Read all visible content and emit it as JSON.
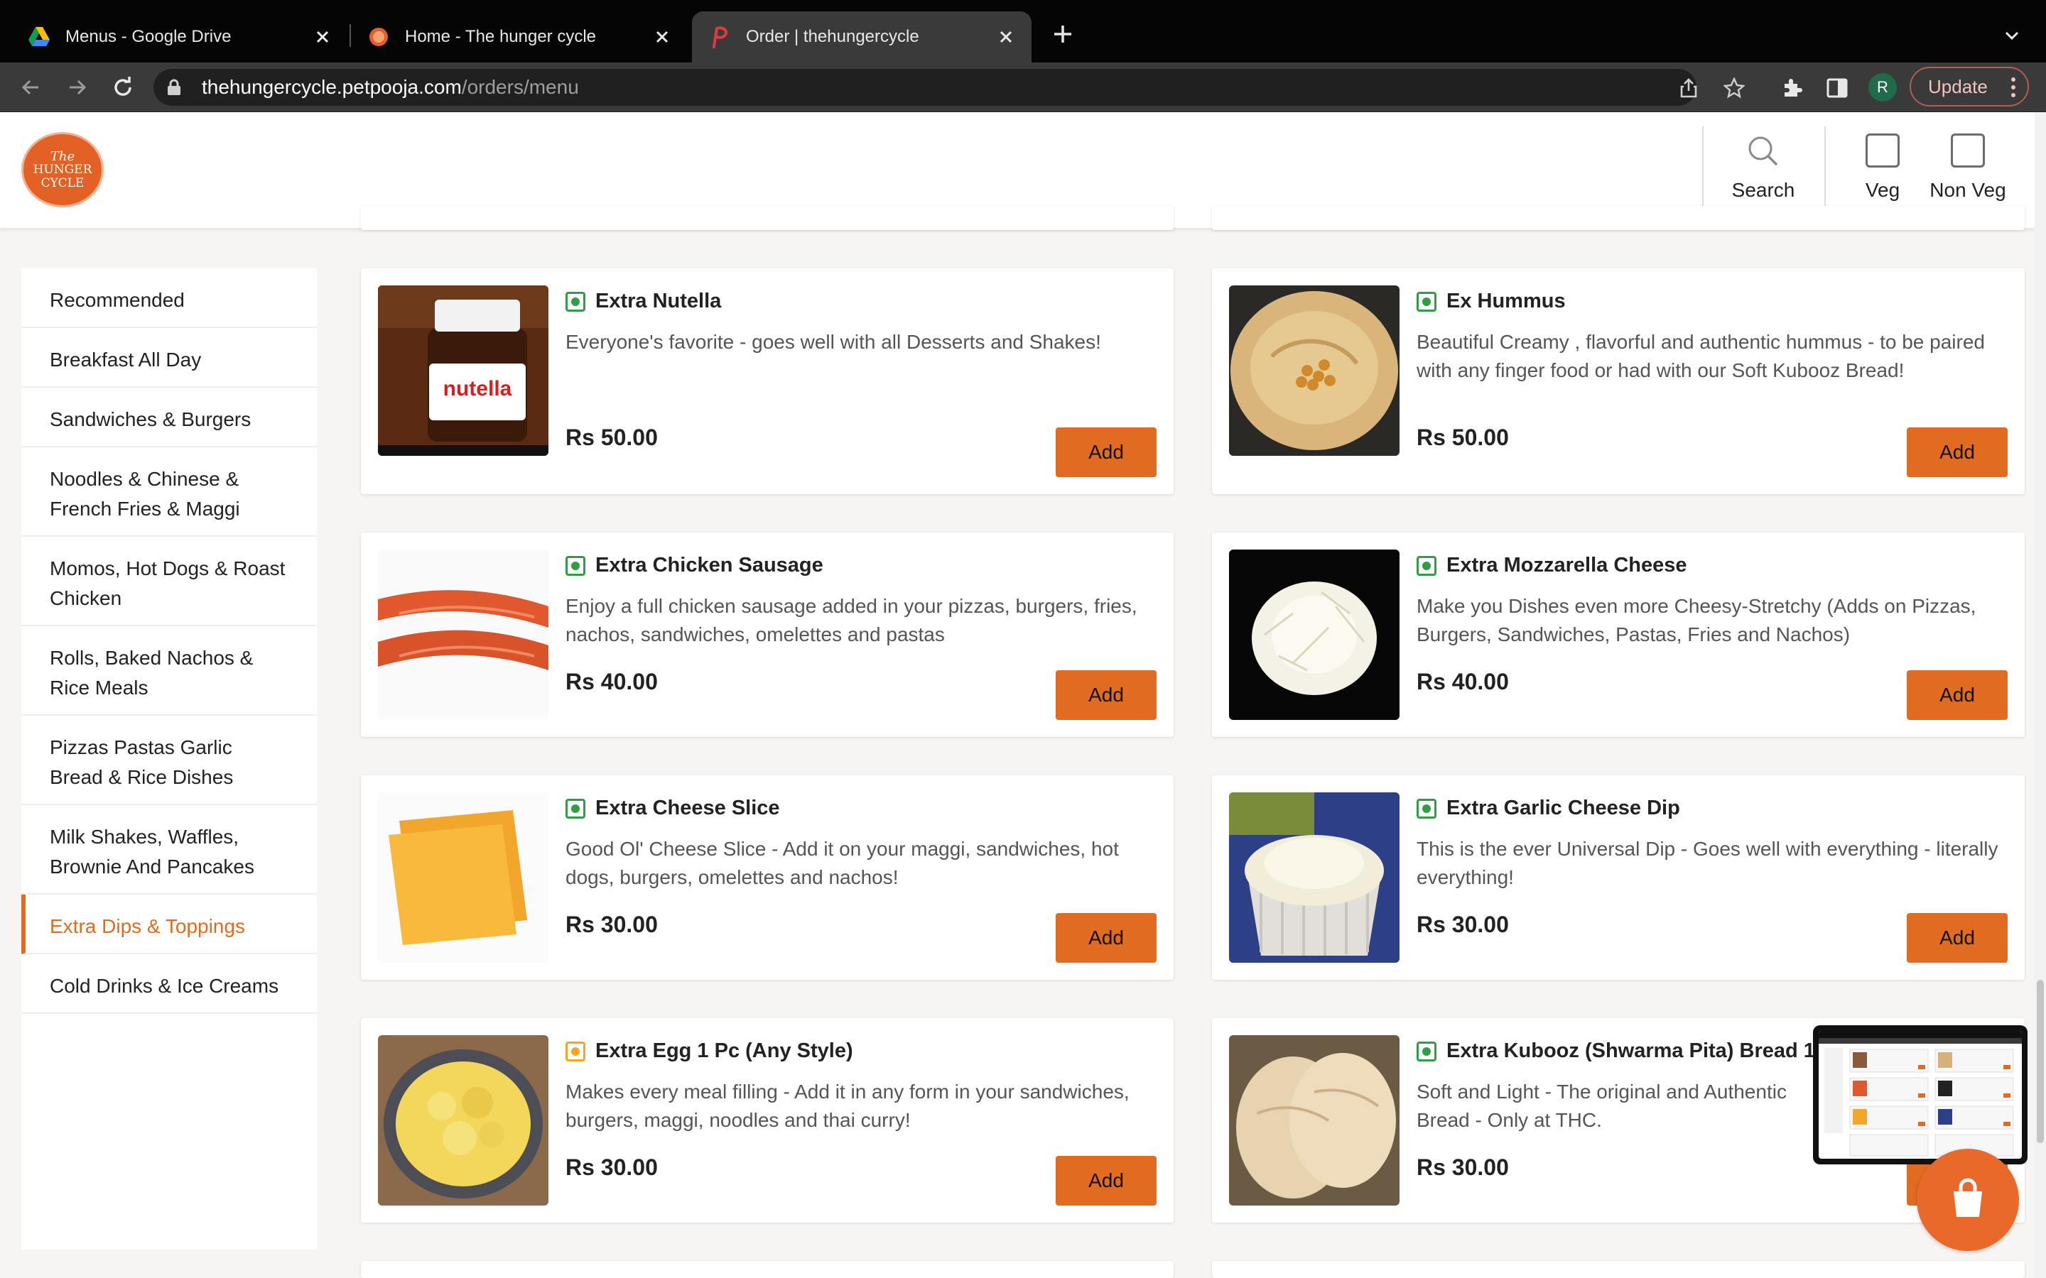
{
  "browser": {
    "tabs": [
      {
        "title": "Menus - Google Drive",
        "icon": "google-drive-icon"
      },
      {
        "title": "Home - The hunger cycle",
        "icon": "site-favicon"
      },
      {
        "title": "Order | thehungercycle",
        "icon": "petpooja-icon"
      }
    ],
    "url_host": "thehungercycle.petpooja.com",
    "url_path": "/orders/menu",
    "profile_initial": "R",
    "update_label": "Update"
  },
  "header": {
    "logo_lines": [
      "The",
      "HUNGER",
      "CYCLE"
    ],
    "search_label": "Search",
    "veg_label": "Veg",
    "nonveg_label": "Non Veg"
  },
  "sidebar": {
    "items": [
      {
        "label": "Recommended"
      },
      {
        "label": "Breakfast All Day"
      },
      {
        "label": "Sandwiches & Burgers"
      },
      {
        "label": "Noodles & Chinese & French Fries & Maggi"
      },
      {
        "label": "Momos, Hot Dogs & Roast Chicken"
      },
      {
        "label": "Rolls, Baked Nachos & Rice Meals"
      },
      {
        "label": "Pizzas Pastas Garlic Bread & Rice Dishes"
      },
      {
        "label": "Milk Shakes, Waffles, Brownie And Pancakes"
      },
      {
        "label": "Extra Dips & Toppings"
      },
      {
        "label": "Cold Drinks & Ice Creams"
      }
    ],
    "active": "Extra Dips & Toppings"
  },
  "menu": {
    "add_label": "Add",
    "items": [
      {
        "name": "Extra Nutella",
        "desc": "Everyone's favorite - goes well with all Desserts and Shakes!",
        "price": "Rs 50.00",
        "type": "veg"
      },
      {
        "name": "Ex Hummus",
        "desc": "Beautiful Creamy , flavorful and authentic hummus - to be paired with any finger food or had with our Soft Kubooz Bread!",
        "price": "Rs 50.00",
        "type": "veg"
      },
      {
        "name": "Extra Chicken Sausage",
        "desc": "Enjoy a full chicken sausage added in your pizzas, burgers, fries, nachos, sandwiches, omelettes and pastas",
        "price": "Rs 40.00",
        "type": "veg"
      },
      {
        "name": "Extra Mozzarella Cheese",
        "desc": "Make you Dishes even more Cheesy-Stretchy (Adds on Pizzas, Burgers, Sandwiches, Pastas, Fries and Nachos)",
        "price": "Rs 40.00",
        "type": "veg"
      },
      {
        "name": "Extra Cheese Slice",
        "desc": "Good Ol' Cheese Slice - Add it on your maggi, sandwiches, hot dogs, burgers, omelettes and nachos!",
        "price": "Rs 30.00",
        "type": "veg"
      },
      {
        "name": "Extra Garlic Cheese Dip",
        "desc": "This is the ever Universal Dip - Goes well with everything - literally everything!",
        "price": "Rs 30.00",
        "type": "veg"
      },
      {
        "name": "Extra Egg 1 Pc (Any Style)",
        "desc": "Makes every meal filling - Add it in any form in your sandwiches, burgers, maggi, noodles and thai curry!",
        "price": "Rs 30.00",
        "type": "egg"
      },
      {
        "name": "Extra Kubooz (Shwarma Pita) Bread 1 P",
        "desc": "Soft and Light - The original and Authentic Bread - Only at THC.",
        "price": "Rs 30.00",
        "type": "veg"
      }
    ]
  },
  "images": {
    "nutella_label": "nutella"
  },
  "colors": {
    "accent": "#e16b20",
    "veg": "#2f9e44",
    "egg": "#f5a623",
    "logo": "#e46125"
  }
}
